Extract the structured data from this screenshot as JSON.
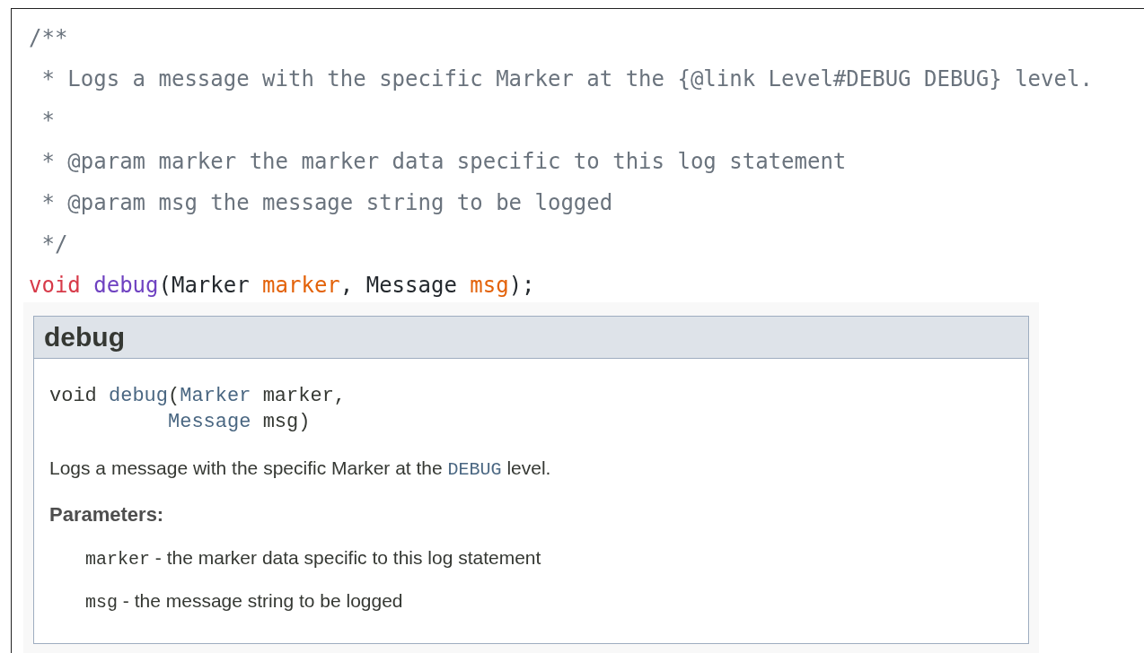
{
  "source": {
    "lines": [
      {
        "kind": "comment",
        "text": "/**"
      },
      {
        "kind": "comment",
        "text": " * Logs a message with the specific Marker at the {@link Level#DEBUG DEBUG} level."
      },
      {
        "kind": "comment",
        "text": " *"
      },
      {
        "kind": "comment",
        "text": " * @param marker the marker data specific to this log statement"
      },
      {
        "kind": "comment",
        "text": " * @param msg the message string to be logged"
      },
      {
        "kind": "comment",
        "text": " */"
      },
      {
        "kind": "code",
        "tokens": [
          {
            "kind": "keyword",
            "text": "void "
          },
          {
            "kind": "method",
            "text": "debug"
          },
          {
            "kind": "plain",
            "text": "(Marker "
          },
          {
            "kind": "param",
            "text": "marker"
          },
          {
            "kind": "plain",
            "text": ", Message "
          },
          {
            "kind": "param",
            "text": "msg"
          },
          {
            "kind": "plain",
            "text": ");"
          }
        ]
      }
    ]
  },
  "doc": {
    "title": "debug",
    "signature": [
      {
        "indent": false,
        "tokens": [
          {
            "kind": "plain",
            "text": "void "
          },
          {
            "kind": "member",
            "text": "debug"
          },
          {
            "kind": "plain",
            "text": "("
          },
          {
            "kind": "type",
            "text": "Marker"
          },
          {
            "kind": "plain",
            "text": " marker,"
          }
        ]
      },
      {
        "indent": true,
        "tokens": [
          {
            "kind": "type",
            "text": "Message"
          },
          {
            "kind": "plain",
            "text": " msg)"
          }
        ]
      }
    ],
    "description": [
      {
        "kind": "text",
        "text": "Logs a message with the specific Marker at the "
      },
      {
        "kind": "link",
        "text": "DEBUG"
      },
      {
        "kind": "text",
        "text": " level."
      }
    ],
    "params_heading": "Parameters:",
    "params": [
      {
        "name": "marker",
        "text": " - the marker data specific to this log statement"
      },
      {
        "name": "msg",
        "text": " - the message string to be logged"
      }
    ]
  }
}
